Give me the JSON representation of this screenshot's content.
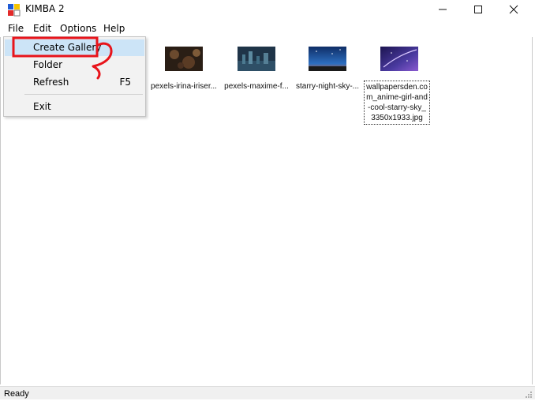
{
  "window": {
    "title": "KIMBA 2",
    "app_icon": "kimba-app-icon"
  },
  "menubar": {
    "items": [
      {
        "label": "File"
      },
      {
        "label": "Edit"
      },
      {
        "label": "Options"
      },
      {
        "label": "Help"
      }
    ]
  },
  "file_menu": {
    "items": [
      {
        "label": "Create Gallery",
        "shortcut": ""
      },
      {
        "label": "Folder",
        "shortcut": ""
      },
      {
        "label": "Refresh",
        "shortcut": "F5"
      },
      {
        "label": "Exit",
        "shortcut": ""
      }
    ]
  },
  "files": [
    {
      "label": "pexels-irina-iriser...",
      "thumb_color": "#3b2a1c"
    },
    {
      "label": "pexels-maxime-f...",
      "thumb_color": "#2b4a60"
    },
    {
      "label": "starry-night-sky-...",
      "thumb_color": "#1f4f8a"
    },
    {
      "label": "wallpapersden.com_anime-girl-and-cool-starry-sky_3350x1933.jpg",
      "thumb_color": "#3d2f7a",
      "selected": true
    }
  ],
  "status": {
    "text": "Ready"
  },
  "colors": {
    "highlight": "#cce4f7",
    "annotation": "#e8141b",
    "menu_bg": "#f2f2f2"
  }
}
